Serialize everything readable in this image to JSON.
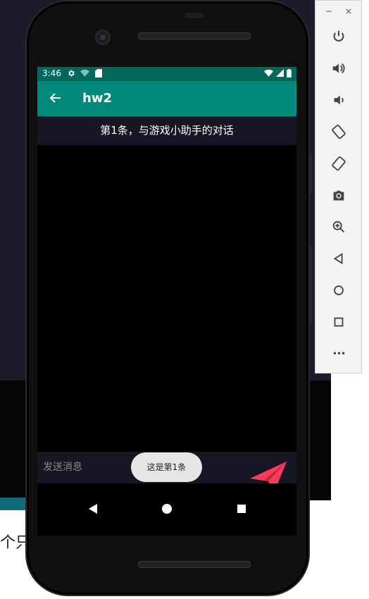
{
  "emulator": {
    "toolbar": {
      "minimize_label": "−",
      "close_label": "×",
      "more_label": "•••"
    }
  },
  "background": {
    "partial_text": "个只是"
  },
  "status_bar": {
    "time": "3:46"
  },
  "app_bar": {
    "title": "hw2"
  },
  "chat": {
    "header": "第1条，与游戏小助手的对话"
  },
  "input": {
    "placeholder": "发送消息",
    "value": ""
  },
  "toast": {
    "text": "这是第1条"
  },
  "colors": {
    "status_bar": "#00695c",
    "app_bar": "#00897b",
    "panel": "#161625",
    "send_icon": "#ff3d5a"
  }
}
